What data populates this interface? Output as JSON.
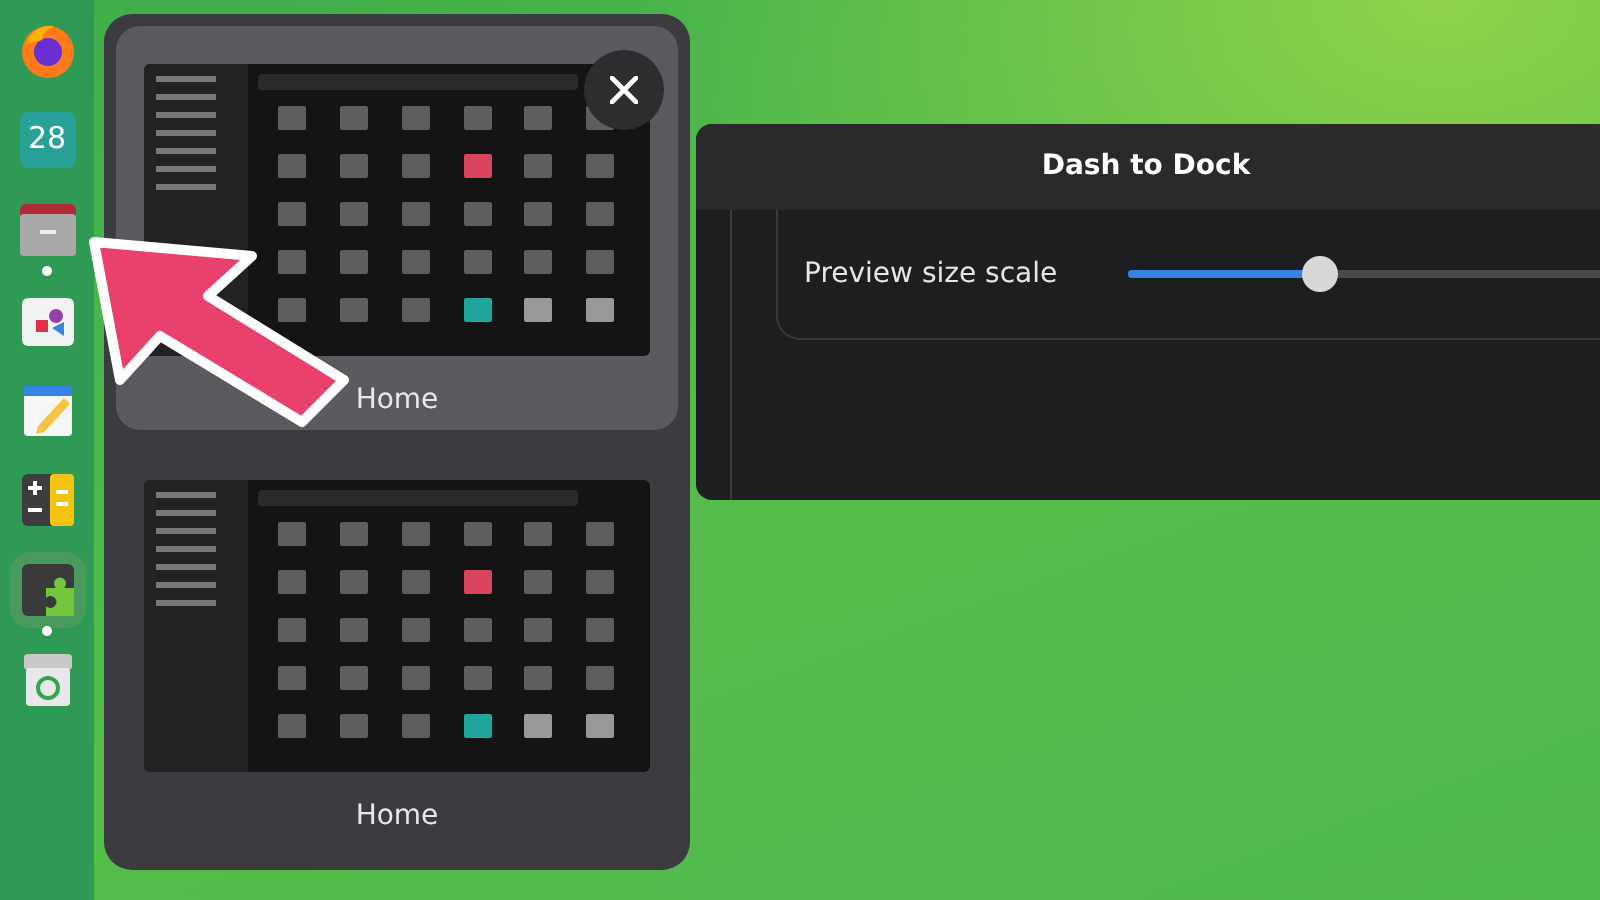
{
  "dock": {
    "items": [
      {
        "kind": "firefox",
        "running": false,
        "selected": false
      },
      {
        "kind": "calendar",
        "label": "28",
        "running": false,
        "selected": false
      },
      {
        "kind": "files",
        "running": true,
        "selected": false
      },
      {
        "kind": "software",
        "running": false,
        "selected": false
      },
      {
        "kind": "notes",
        "running": false,
        "selected": false
      },
      {
        "kind": "calculator",
        "running": false,
        "selected": false
      },
      {
        "kind": "extensions",
        "running": true,
        "selected": true
      },
      {
        "kind": "trash",
        "running": false,
        "selected": false
      }
    ]
  },
  "window_previews": {
    "windows": [
      {
        "title": "Home",
        "selected": true
      },
      {
        "title": "Home",
        "selected": false
      }
    ]
  },
  "settings_window": {
    "title": "Dash to Dock",
    "rows": [
      {
        "label": "Preview size scale",
        "level": 0.4
      }
    ]
  }
}
